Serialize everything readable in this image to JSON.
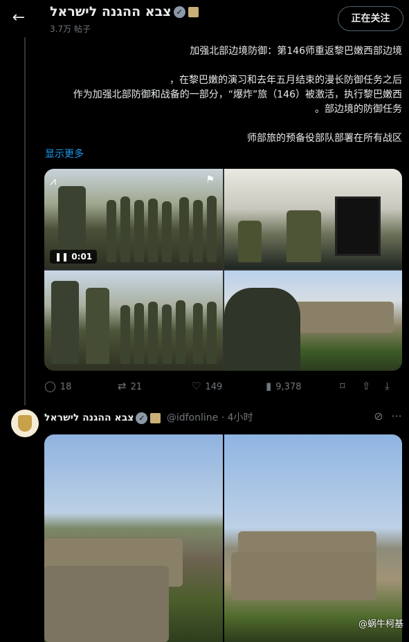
{
  "header": {
    "back_label": "←",
    "account_name": "צבא ההגנה לישראל",
    "post_count": "3.7万 帖子",
    "follow_label": "正在关注"
  },
  "tweet": {
    "lines": [
      "加强北部边境防御：第146师重返黎巴嫩西部边境",
      "",
      "，在黎巴嫩的演习和去年五月结束的漫长防御任务之后",
      "作为加强北部防御和战备的一部分，“爆炸”旅（146）被激活，执行黎巴嫩西",
      "。部边境的防御任务",
      "",
      "师部旅的预备役部队部署在所有战区"
    ],
    "show_more": "显示更多",
    "video_time": "0:01",
    "stats": {
      "replies": "18",
      "retweets": "21",
      "likes": "149",
      "views": "9,378"
    }
  },
  "tweet2": {
    "name": "צבא ההגנה לישראל",
    "handle": "@idfonline",
    "dot": "·",
    "time": "4小时"
  },
  "watermark": "@蜗牛柯基",
  "icons": {
    "back": "arrow-left-icon",
    "verified": "verified-badge-icon",
    "reply": "reply-icon",
    "retweet": "retweet-icon",
    "like": "heart-icon",
    "views": "views-icon",
    "bookmark": "bookmark-icon",
    "share": "share-icon",
    "download": "download-icon"
  },
  "colors": {
    "background": "#000000",
    "text": "#e7e9ea",
    "secondary": "#71767b",
    "link": "#1d9bf0"
  }
}
